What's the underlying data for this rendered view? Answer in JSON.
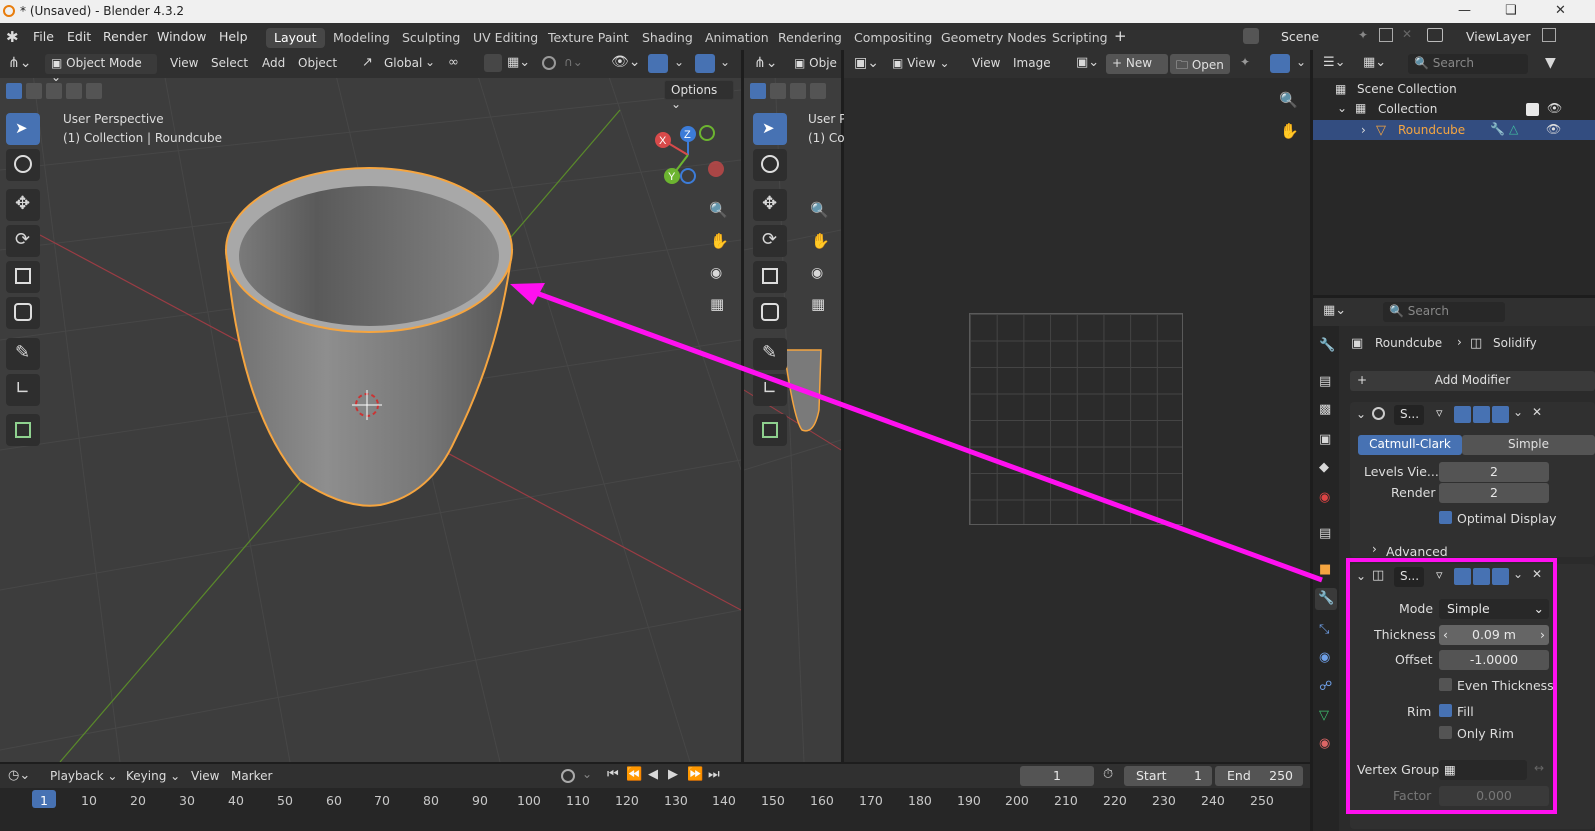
{
  "window": {
    "title": "* (Unsaved) - Blender 4.3.2"
  },
  "menu": [
    "File",
    "Edit",
    "Render",
    "Window",
    "Help"
  ],
  "workspaces": [
    "Layout",
    "Modeling",
    "Sculpting",
    "UV Editing",
    "Texture Paint",
    "Shading",
    "Animation",
    "Rendering",
    "Compositing",
    "Geometry Nodes",
    "Scripting"
  ],
  "active_workspace": "Layout",
  "scene": {
    "name": "Scene",
    "view_layer": "ViewLayer"
  },
  "viewport": {
    "mode": "Object Mode",
    "menus": [
      "View",
      "Select",
      "Add",
      "Object"
    ],
    "orientation": "Global",
    "options": "Options",
    "info_line1": "User Perspective",
    "info_line2": "(1) Collection | Roundcube",
    "gizmo": {
      "x": "X",
      "y": "Y",
      "z": "Z"
    }
  },
  "viewport2": {
    "mode": "Obje",
    "info_line1": "User P",
    "info_line2": "(1) Co"
  },
  "image_editor": {
    "menus": [
      "View",
      "Image"
    ],
    "view_select": "View",
    "new": "New",
    "open": "Open"
  },
  "outliner": {
    "search_placeholder": "Search",
    "scene_collection": "Scene Collection",
    "collection": "Collection",
    "object": "Roundcube"
  },
  "properties": {
    "search_placeholder": "Search",
    "breadcrumb_object": "Roundcube",
    "breadcrumb_modifier": "Solidify",
    "add_modifier": "Add Modifier",
    "subsurf": {
      "name": "S...",
      "tab_catmull": "Catmull-Clark",
      "tab_simple": "Simple",
      "levels_label": "Levels Vie...",
      "levels_value": "2",
      "render_label": "Render",
      "render_value": "2",
      "optimal_display": "Optimal Display",
      "advanced": "Advanced"
    },
    "solidify": {
      "name": "S...",
      "mode_label": "Mode",
      "mode_value": "Simple",
      "thickness_label": "Thickness",
      "thickness_value": "0.09 m",
      "offset_label": "Offset",
      "offset_value": "-1.0000",
      "even_thickness": "Even Thickness",
      "rim_label": "Rim",
      "fill": "Fill",
      "only_rim": "Only Rim",
      "vertex_group_label": "Vertex Group",
      "factor_label": "Factor",
      "factor_value": "0.000"
    }
  },
  "timeline": {
    "menus": [
      "Playback",
      "Keying",
      "View",
      "Marker"
    ],
    "current_frame": "1",
    "start_label": "Start",
    "start_value": "1",
    "end_label": "End",
    "end_value": "250",
    "ticks": [
      "1",
      "10",
      "20",
      "30",
      "40",
      "50",
      "60",
      "70",
      "80",
      "90",
      "100",
      "110",
      "120",
      "130",
      "140",
      "150",
      "160",
      "170",
      "180",
      "190",
      "200",
      "210",
      "220",
      "230",
      "240",
      "250"
    ]
  },
  "colors": {
    "accent": "#4772b3",
    "selection": "#f5a540",
    "annotation": "#ff10f0",
    "background": "#3d3d3d"
  }
}
